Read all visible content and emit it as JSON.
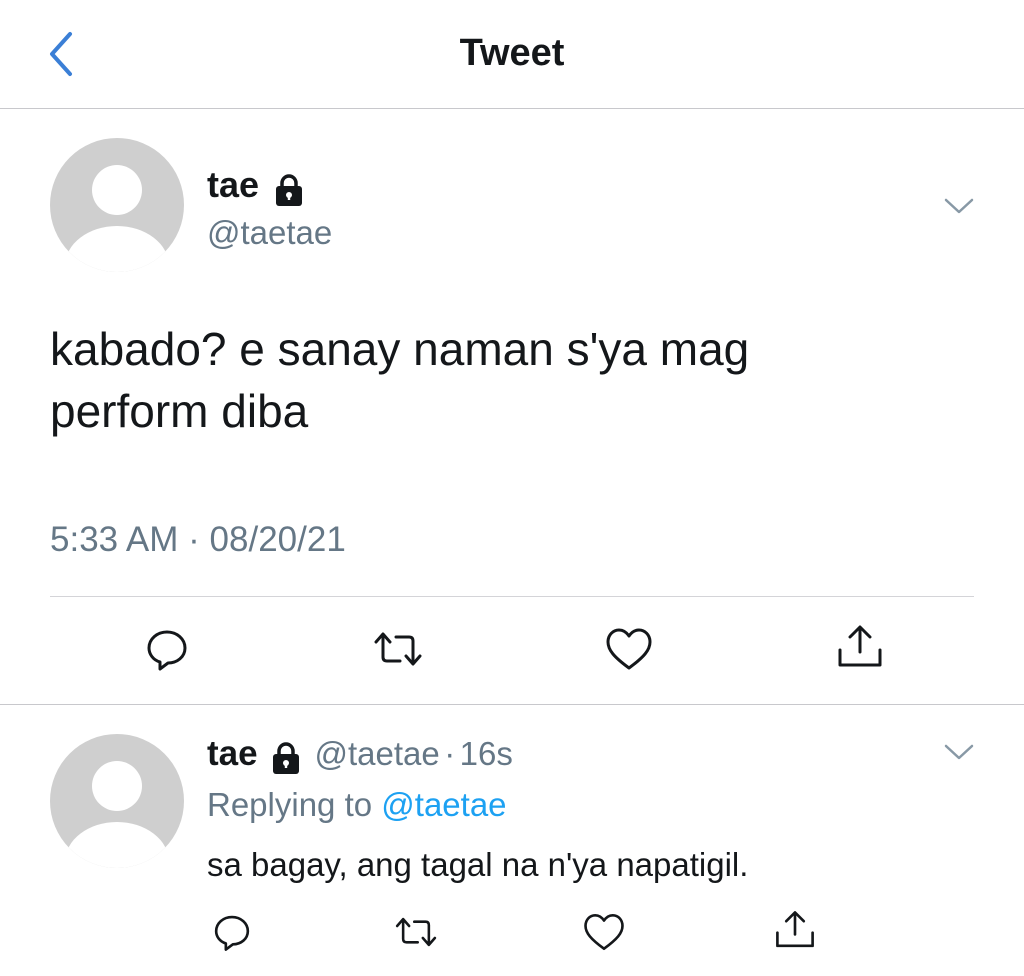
{
  "header": {
    "title": "Tweet",
    "back_icon": "chevron-left-icon",
    "accent": "#3b7fd6"
  },
  "main_tweet": {
    "display_name": "tae",
    "handle": "@taetae",
    "text_line1": "kabado? e sanay naman s'ya mag",
    "text_line2": "perform diba",
    "time": "5:33 AM",
    "separator": "·",
    "date": "08/20/21",
    "icons": [
      "lock-icon",
      "chevron-down-icon",
      "reply-icon",
      "retweet-icon",
      "like-icon",
      "share-icon"
    ]
  },
  "reply_tweet": {
    "display_name": "tae",
    "handle": "@taetae",
    "separator": "·",
    "age": "16s",
    "replying_prefix": "Replying to",
    "replying_to": "@taetae",
    "text": "sa bagay, ang tagal na n'ya napatigil.",
    "link_color": "#1da1f2"
  },
  "colors": {
    "text": "#14171a",
    "muted": "#657786",
    "divider": "#d4d4d8",
    "avatar": "#cfcfcf"
  }
}
